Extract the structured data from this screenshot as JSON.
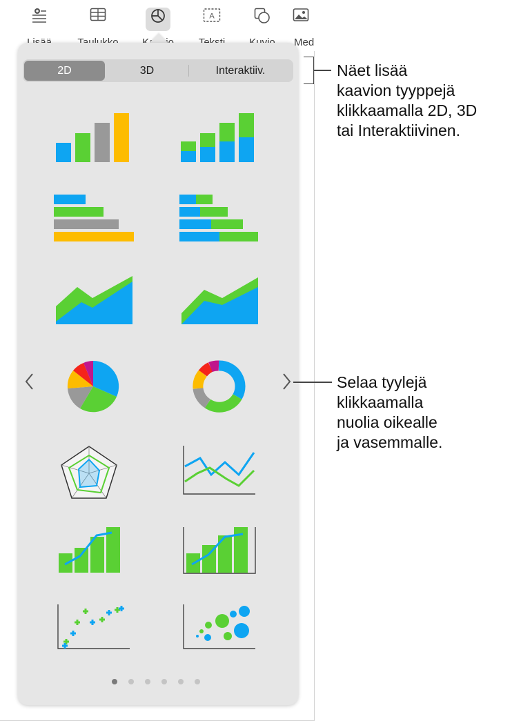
{
  "toolbar": {
    "items": [
      {
        "label": "Lisää",
        "icon": "insert-icon"
      },
      {
        "label": "Taulukko",
        "icon": "table-icon"
      },
      {
        "label": "Kaavio",
        "icon": "chart-icon"
      },
      {
        "label": "Teksti",
        "icon": "text-box-icon"
      },
      {
        "label": "Kuvio",
        "icon": "shape-icon"
      },
      {
        "label": "Media",
        "icon": "media-icon"
      }
    ],
    "active_label": "Kaavio"
  },
  "chart_picker": {
    "tabs": [
      {
        "label": "2D",
        "selected": true
      },
      {
        "label": "3D",
        "selected": false
      },
      {
        "label": "Interaktiiv.",
        "selected": false
      }
    ],
    "styles": [
      "column-chart",
      "stacked-column-chart",
      "bar-chart",
      "stacked-bar-chart",
      "area-chart",
      "stacked-area-chart",
      "pie-chart",
      "donut-chart",
      "radar-chart",
      "line-chart",
      "mixed-chart",
      "two-axis-chart",
      "scatter-chart",
      "bubble-chart"
    ],
    "page_count": 6,
    "current_page": 1,
    "prev_icon": "chevron-left-icon",
    "next_icon": "chevron-right-icon"
  },
  "callouts": {
    "top": "Näet lisää\nkaavion tyyppejä\nklikkaamalla 2D, 3D\ntai Interaktiivinen.",
    "middle": "Selaa tyylejä\nklikkaamalla\nnuolia oikealle\nja vasemmalle."
  },
  "colors": {
    "blue": "#0ea5f2",
    "green": "#5ad034",
    "gray": "#999999",
    "yellow": "#fdbc00",
    "red": "#f5241a",
    "purple": "#c0168c"
  }
}
